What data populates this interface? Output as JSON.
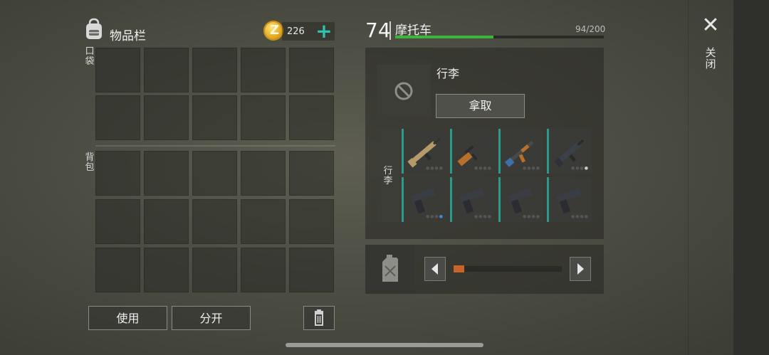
{
  "inventory": {
    "title": "物品栏",
    "pocket_label": "口袋",
    "backpack_label": "背包",
    "coins": "226",
    "add_symbol": "+",
    "use_button": "使用",
    "split_button": "分开"
  },
  "vehicle": {
    "level": "74",
    "name": "摩托车",
    "capacity": "94/200",
    "capacity_fraction": 0.47,
    "luggage_title": "行李",
    "take_button": "拿取",
    "luggage_label": "行李",
    "items": [
      {
        "icon": "assault-rifle-tan-icon"
      },
      {
        "icon": "sniper-rifle-wood-icon"
      },
      {
        "icon": "ak-rifle-icon"
      },
      {
        "icon": "smg-dark-icon"
      },
      {
        "icon": "pistol-icon"
      },
      {
        "icon": "pistol-icon"
      },
      {
        "icon": "pistol-icon"
      },
      {
        "icon": "pistol-icon"
      }
    ]
  },
  "fuel": {
    "slider_fraction": 0.1
  },
  "close": {
    "symbol": "✕",
    "label": "关闭"
  },
  "colors": {
    "accent_teal": "#2fc2b0",
    "capacity_green": "#3cb53c",
    "slider_orange": "#c8632a",
    "coin_gold": "#e0a51c"
  }
}
